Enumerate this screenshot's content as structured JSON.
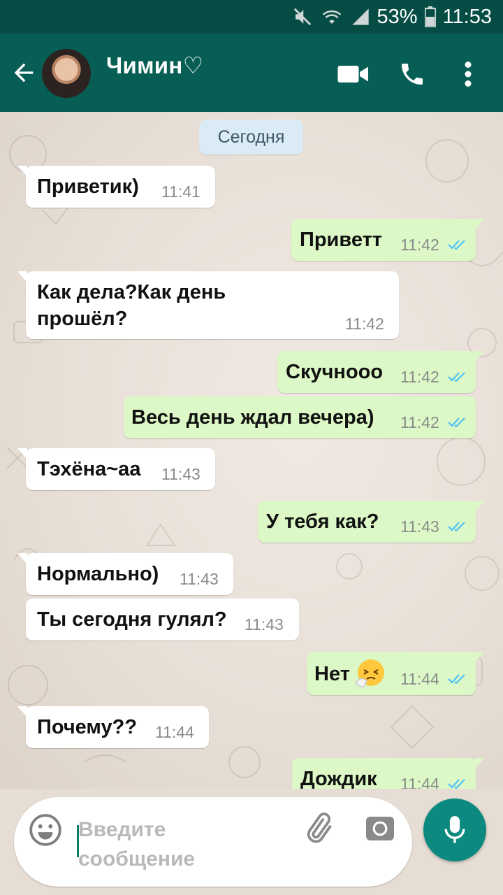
{
  "status_bar": {
    "battery": "53%",
    "time": "11:53",
    "icons": [
      "mute-icon",
      "wifi-icon",
      "signal-icon",
      "battery-icon"
    ]
  },
  "header": {
    "contact_name": "Чимин♡",
    "icons": [
      "back-arrow-icon",
      "video-call-icon",
      "phone-icon",
      "more-vert-icon"
    ]
  },
  "chat": {
    "date_label": "Сегодня",
    "messages": [
      {
        "dir": "in",
        "text": "Приветик)",
        "time": "11:41"
      },
      {
        "dir": "out",
        "text": "Приветт",
        "time": "11:42",
        "read": true
      },
      {
        "dir": "in",
        "text_line1": "Как дела?Как день",
        "text_line2": "прошёл?",
        "time": "11:42"
      },
      {
        "dir": "out",
        "text": "Скучнооо",
        "time": "11:42",
        "read": true
      },
      {
        "dir": "out",
        "text": "Весь день ждал вечера)",
        "time": "11:42",
        "read": true
      },
      {
        "dir": "in",
        "text": "Тэхёна~аа",
        "time": "11:43"
      },
      {
        "dir": "out",
        "text": "У тебя как?",
        "time": "11:43",
        "read": true
      },
      {
        "dir": "in",
        "text": "Нормально)",
        "time": "11:43"
      },
      {
        "dir": "in",
        "text": "Ты сегодня гулял?",
        "time": "11:43"
      },
      {
        "dir": "out",
        "text": "Нет",
        "emoji": "sneezing-face",
        "time": "11:44",
        "read": true
      },
      {
        "dir": "in",
        "text": "Почему??",
        "time": "11:44"
      },
      {
        "dir": "out",
        "text": "Дождик",
        "time": "11:44",
        "read": true
      }
    ]
  },
  "composer": {
    "placeholder_line1": "Введите",
    "placeholder_line2": "сообщение",
    "icons": [
      "emoji-icon",
      "attach-icon",
      "camera-icon",
      "mic-icon"
    ]
  },
  "colors": {
    "header": "#075e54",
    "status_bar": "#054d44",
    "incoming_bubble": "#ffffff",
    "outgoing_bubble": "#dcf8c6",
    "read_ticks": "#4fc3f7",
    "mic_button": "#0d8a7f"
  }
}
